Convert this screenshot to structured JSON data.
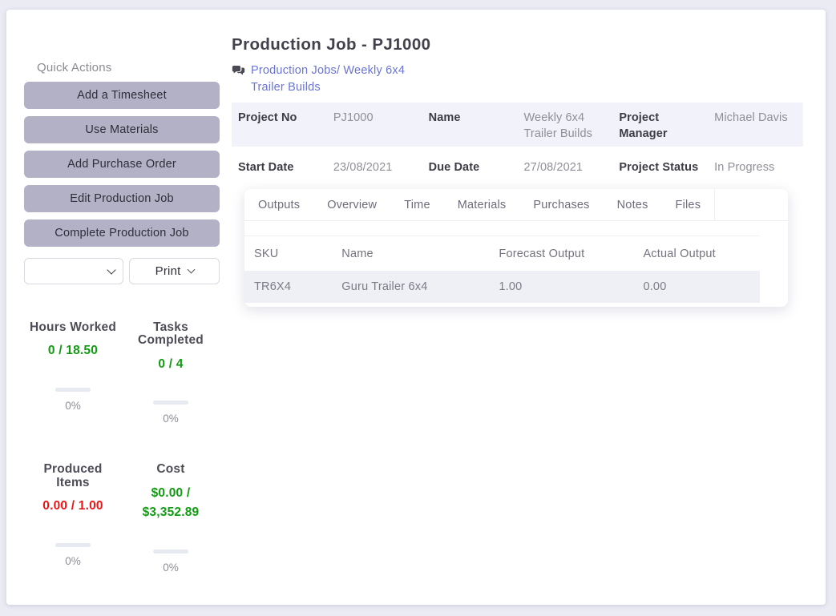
{
  "colors": {
    "page_background": "#ebebf4",
    "card_background": "#ffffff",
    "link_accent": "#6b74d8",
    "quick_action_button": "#b3b1c6",
    "positive_green": "#119c11",
    "negative_red": "#f01414",
    "table_row_highlight": "#eef0f5",
    "info_row_highlight": "#f2f2fa"
  },
  "header": {
    "title": "Production Job - PJ1000",
    "breadcrumb": "Production Jobs/ Weekly 6x4 Trailer Builds",
    "breadcrumb_icon": "comments-icon"
  },
  "quick_actions": {
    "title": "Quick Actions",
    "buttons": [
      "Add a Timesheet",
      "Use Materials",
      "Add Purchase Order",
      "Edit Production Job",
      "Complete Production Job"
    ],
    "select_value": "",
    "print_label": "Print"
  },
  "stats": [
    {
      "label": "Hours Worked",
      "value": "0 / 18.50",
      "percent": "0%",
      "value_color": "#119c11"
    },
    {
      "label": "Tasks Completed",
      "value": "0 / 4",
      "percent": "0%",
      "value_color": "#119c11"
    },
    {
      "label": "Produced Items",
      "value": "0.00 / 1.00",
      "percent": "0%",
      "value_color": "#f01414"
    },
    {
      "label": "Cost",
      "value": "$0.00 / $3,352.89",
      "percent": "0%",
      "value_color": "#119c11"
    }
  ],
  "details": {
    "rows": [
      [
        {
          "label": "Project No",
          "value": "PJ1000"
        },
        {
          "label": "Name",
          "value": "Weekly 6x4 Trailer Builds"
        },
        {
          "label": "Project Manager",
          "value": "Michael Davis"
        }
      ],
      [
        {
          "label": "Start Date",
          "value": "23/08/2021"
        },
        {
          "label": "Due Date",
          "value": "27/08/2021"
        },
        {
          "label": "Project Status",
          "value": "In Progress"
        }
      ]
    ]
  },
  "tabs": [
    {
      "label": "Outputs"
    },
    {
      "label": "Overview"
    },
    {
      "label": "Time"
    },
    {
      "label": "Materials"
    },
    {
      "label": "Purchases"
    },
    {
      "label": "Notes"
    },
    {
      "label": "Files"
    }
  ],
  "outputs_table": {
    "headers": [
      "SKU",
      "Name",
      "Forecast Output",
      "Actual Output"
    ],
    "rows": [
      [
        "TR6X4",
        "Guru Trailer 6x4",
        "1.00",
        "0.00"
      ]
    ]
  }
}
